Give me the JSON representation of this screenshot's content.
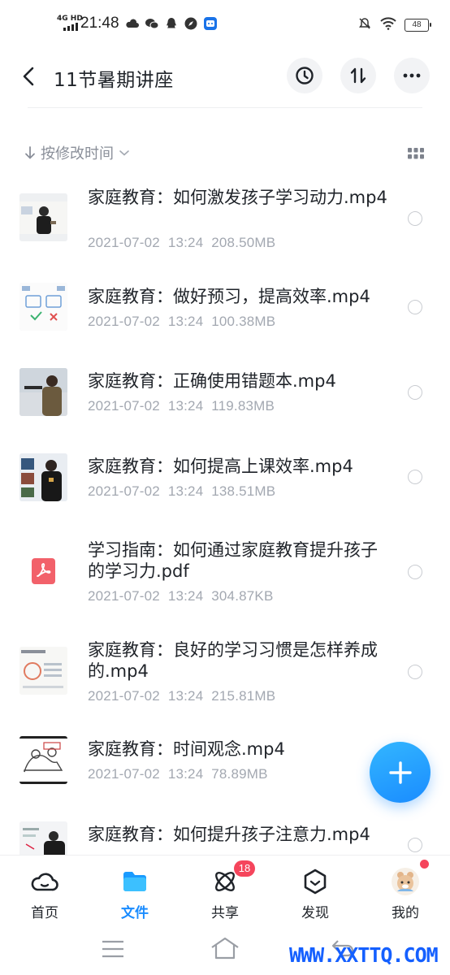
{
  "status_bar": {
    "network": "4G HD",
    "time": "21:48",
    "battery": "48"
  },
  "header": {
    "title": "11节暑期讲座"
  },
  "sort": {
    "label": "按修改时间"
  },
  "files": [
    {
      "name": "家庭教育：如何激发孩子学习动力.mp4",
      "date": "2021-07-02",
      "time": "13:24",
      "size": "208.50MB",
      "type": "video"
    },
    {
      "name": "家庭教育：做好预习，提高效率.mp4",
      "date": "2021-07-02",
      "time": "13:24",
      "size": "100.38MB",
      "type": "video"
    },
    {
      "name": "家庭教育：正确使用错题本.mp4",
      "date": "2021-07-02",
      "time": "13:24",
      "size": "119.83MB",
      "type": "video"
    },
    {
      "name": "家庭教育：如何提高上课效率.mp4",
      "date": "2021-07-02",
      "time": "13:24",
      "size": "138.51MB",
      "type": "video"
    },
    {
      "name": "学习指南：如何通过家庭教育提升孩子的学习力.pdf",
      "date": "2021-07-02",
      "time": "13:24",
      "size": "304.87KB",
      "type": "pdf"
    },
    {
      "name": "家庭教育：良好的学习习惯是怎样养成的.mp4",
      "date": "2021-07-02",
      "time": "13:24",
      "size": "215.81MB",
      "type": "video"
    },
    {
      "name": "家庭教育：时间观念.mp4",
      "date": "2021-07-02",
      "time": "13:24",
      "size": "78.89MB",
      "type": "video"
    },
    {
      "name": "家庭教育：如何提升孩子注意力.mp4",
      "date": "",
      "time": "",
      "size": "",
      "type": "video"
    }
  ],
  "tabs": [
    {
      "label": "首页",
      "icon": "cloud-icon"
    },
    {
      "label": "文件",
      "icon": "folder-icon"
    },
    {
      "label": "共享",
      "icon": "atom-icon"
    },
    {
      "label": "发现",
      "icon": "discover-icon"
    },
    {
      "label": "我的",
      "icon": "avatar-icon"
    }
  ],
  "share_badge": "18",
  "watermark": "WWW.XXTTQ.COM",
  "colors": {
    "accent": "#1a8cff",
    "badge": "#f5455c",
    "meta_text": "#a3a8b1"
  }
}
